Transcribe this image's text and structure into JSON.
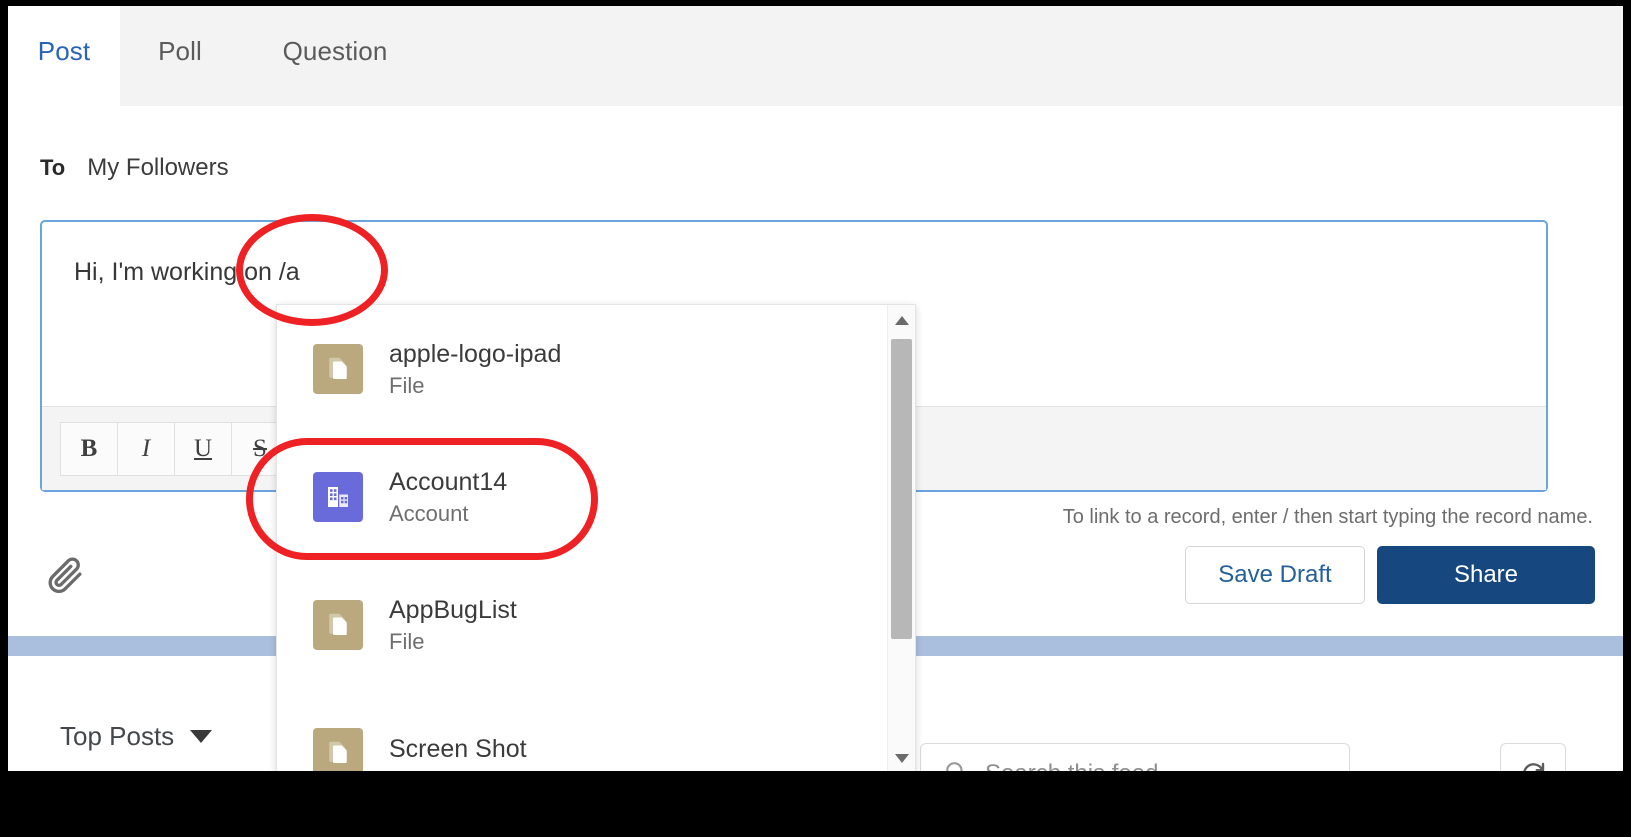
{
  "tabs": [
    {
      "label": "Post",
      "active": true
    },
    {
      "label": "Poll",
      "active": false
    },
    {
      "label": "Question",
      "active": false
    }
  ],
  "audience": {
    "to_label": "To",
    "to_value": "My Followers"
  },
  "composer": {
    "text": "Hi, I'm working on /a",
    "toolbar": {
      "bold": "B",
      "italic": "I",
      "underline": "U",
      "strikethrough": "S"
    },
    "attach_icon": "paperclip-icon"
  },
  "hint": {
    "text": "To link to a record, enter / then start typing the record name."
  },
  "actions": {
    "save_draft": "Save Draft",
    "share": "Share"
  },
  "autocomplete": {
    "items": [
      {
        "title": "apple-logo-ipad",
        "subtitle": "File",
        "icon": "file-icon",
        "kind": "file"
      },
      {
        "title": "Account14",
        "subtitle": "Account",
        "icon": "account-icon",
        "kind": "account"
      },
      {
        "title": "AppBugList",
        "subtitle": "File",
        "icon": "file-icon",
        "kind": "file"
      },
      {
        "title": "Screen Shot",
        "subtitle": "",
        "icon": "file-icon",
        "kind": "file"
      }
    ],
    "scroll_up_icon": "chevron-up-icon",
    "scroll_down_icon": "chevron-down-icon"
  },
  "feed": {
    "sort_label": "Top Posts",
    "sort_caret": "chevron-down-icon",
    "search_placeholder": "Search this feed...",
    "search_value": "",
    "search_icon": "search-icon",
    "refresh_icon": "refresh-icon"
  },
  "colors": {
    "accent_blue": "#2a64b4",
    "primary_button": "#17477f",
    "annotation_red": "#ee2124",
    "file_icon": "#baa97f",
    "account_icon": "#6a6bdb",
    "divider_band": "#aabfdd"
  }
}
